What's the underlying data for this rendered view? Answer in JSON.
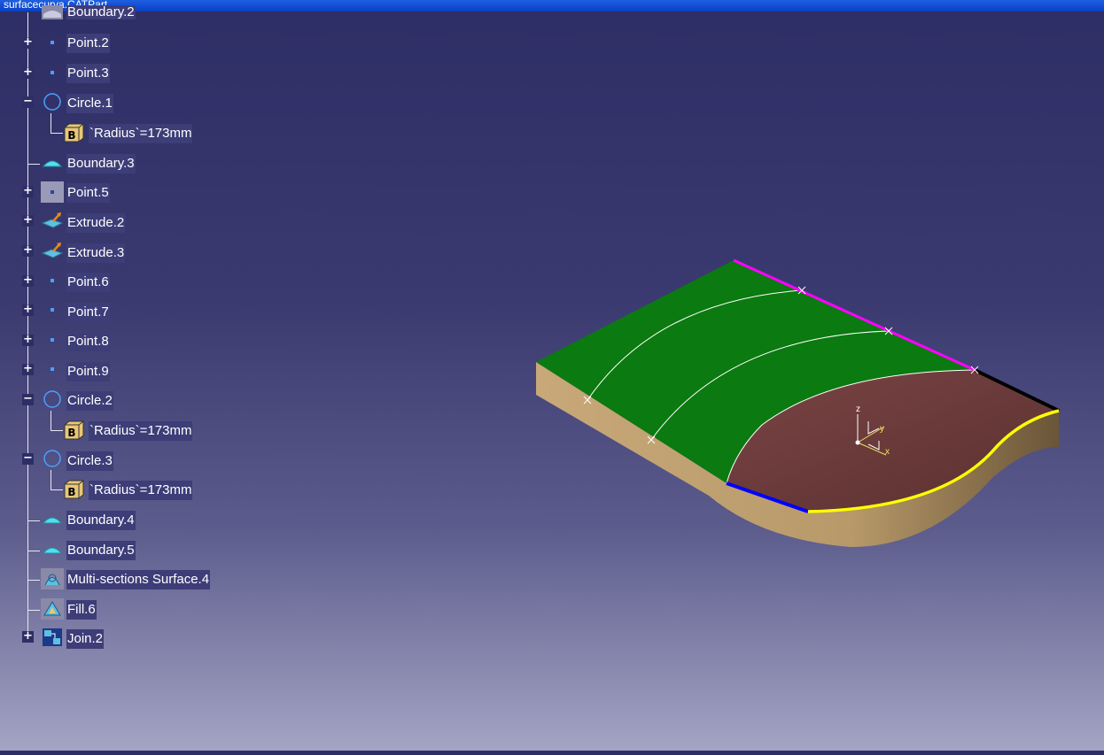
{
  "window": {
    "title": "surfacecurva.CATPart"
  },
  "tree": {
    "items": [
      {
        "label": "Boundary.2"
      },
      {
        "label": "Point.2"
      },
      {
        "label": "Point.3"
      },
      {
        "label": "Circle.1"
      },
      {
        "label": "`Radius`=173mm"
      },
      {
        "label": "Boundary.3"
      },
      {
        "label": "Point.5"
      },
      {
        "label": "Extrude.2"
      },
      {
        "label": "Extrude.3"
      },
      {
        "label": "Point.6"
      },
      {
        "label": "Point.7"
      },
      {
        "label": "Point.8"
      },
      {
        "label": "Point.9"
      },
      {
        "label": "Circle.2"
      },
      {
        "label": "`Radius`=173mm"
      },
      {
        "label": "Circle.3"
      },
      {
        "label": "`Radius`=173mm"
      },
      {
        "label": "Boundary.4"
      },
      {
        "label": "Boundary.5"
      },
      {
        "label": "Multi-sections Surface.4"
      },
      {
        "label": "Fill.6"
      },
      {
        "label": "Join.2"
      }
    ]
  },
  "expanders": {
    "plus": "+",
    "minus": "−"
  },
  "icons": {
    "boundary": "boundary-icon",
    "point": "point-icon",
    "circle": "circle-icon",
    "parameter": "formula-parameter-icon",
    "extrude": "extrude-icon",
    "multisection": "multi-sections-surface-icon",
    "fill": "fill-icon",
    "join": "join-icon"
  },
  "compass": {
    "z": "z",
    "y": "y",
    "x": "x"
  },
  "colors": {
    "background_top": "#2e2e66",
    "background_bottom": "#a4a4c4",
    "tree_label_bg": "#3d3d78",
    "top_surface": "#0b7a10",
    "side_wall": "#b89a6a",
    "curved_surface": "#6a3a3a",
    "edge_magenta": "#ff00ff",
    "edge_yellow": "#ffff00",
    "edge_blue": "#0000ff",
    "edge_black": "#000000"
  }
}
